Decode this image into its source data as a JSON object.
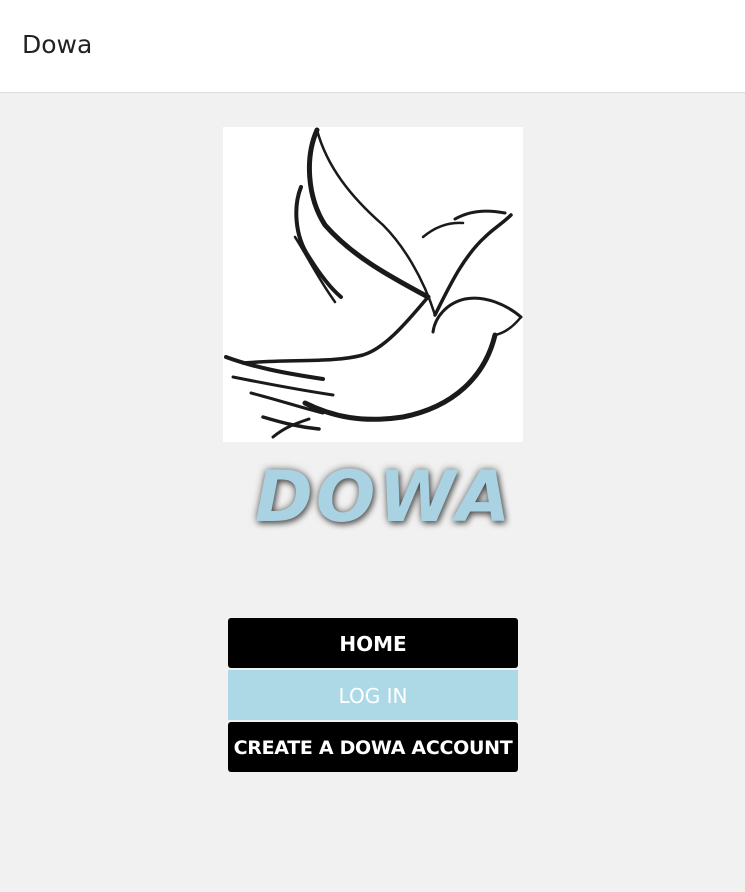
{
  "header": {
    "title": "Dowa"
  },
  "logo": {
    "icon": "dove-icon",
    "wordmark": "DOWA",
    "wordmark_color": "#a9d3e2"
  },
  "menu": {
    "home_label": "HOME",
    "login_label": "LOG IN",
    "create_account_label": "CREATE A DOWA ACCOUNT"
  },
  "colors": {
    "background": "#f1f1f1",
    "button_dark": "#000000",
    "button_active": "#add8e6"
  }
}
